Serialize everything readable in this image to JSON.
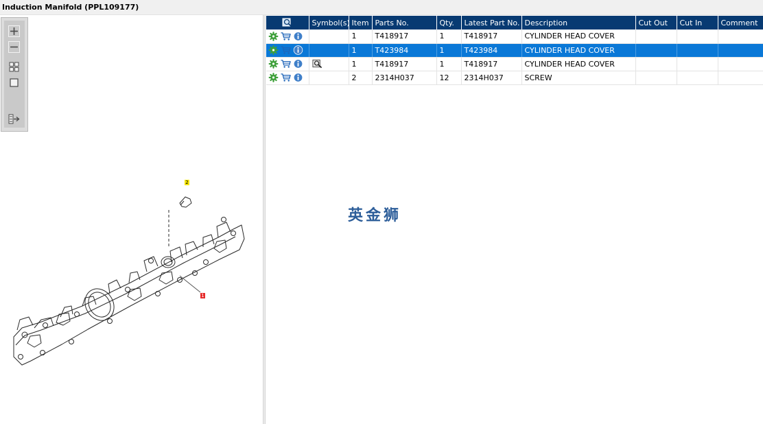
{
  "window": {
    "title": "Induction Manifold (PPL109177)"
  },
  "toolbar": {
    "buttons": [
      {
        "icon": "zoom-in-icon"
      },
      {
        "icon": "zoom-out-icon"
      },
      {
        "icon": "fit-all-icon"
      },
      {
        "icon": "actual-size-icon"
      },
      {
        "icon": "export-list-icon"
      }
    ]
  },
  "diagram": {
    "callouts": [
      {
        "label": "2",
        "color": "#f5e600"
      },
      {
        "label": "1",
        "color": "#e52b2b"
      }
    ]
  },
  "table": {
    "columns": [
      "",
      "Symbol(s)",
      "Item",
      "Parts No.",
      "Qty.",
      "Latest Part No.",
      "Description",
      "Cut Out",
      "Cut In",
      "Comment"
    ],
    "rows": [
      {
        "item": "1",
        "parts_no": "T418917",
        "qty": "1",
        "latest_part_no": "T418917",
        "description": "CYLINDER HEAD COVER",
        "cut_out": "",
        "cut_in": "",
        "comment": "",
        "selected": false,
        "has_symbol": false
      },
      {
        "item": "1",
        "parts_no": "T423984",
        "qty": "1",
        "latest_part_no": "T423984",
        "description": "CYLINDER HEAD COVER",
        "cut_out": "",
        "cut_in": "",
        "comment": "",
        "selected": true,
        "has_symbol": false
      },
      {
        "item": "1",
        "parts_no": "T418917",
        "qty": "1",
        "latest_part_no": "T418917",
        "description": "CYLINDER HEAD COVER",
        "cut_out": "",
        "cut_in": "",
        "comment": "",
        "selected": false,
        "has_symbol": true
      },
      {
        "item": "2",
        "parts_no": "2314H037",
        "qty": "12",
        "latest_part_no": "2314H037",
        "description": "SCREW",
        "cut_out": "",
        "cut_in": "",
        "comment": "",
        "selected": false,
        "has_symbol": false
      }
    ]
  },
  "watermark": {
    "text": "英金狮"
  },
  "colors": {
    "header": "#073a72",
    "selected_row": "#0a78d7",
    "gear": "#3ea03a",
    "info": "#3f7fc9",
    "cart": "#1e64b8"
  }
}
